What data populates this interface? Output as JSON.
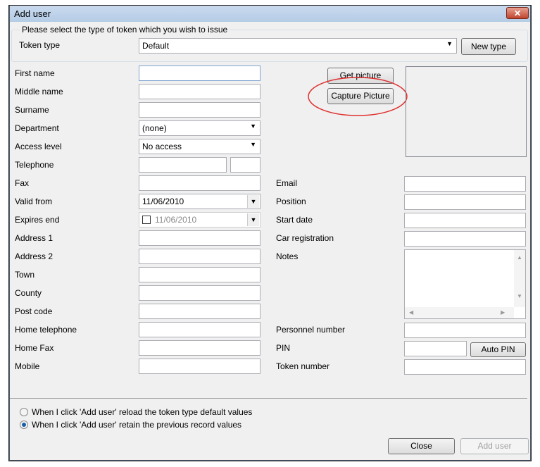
{
  "window": {
    "title": "Add user",
    "close_icon": "close-icon"
  },
  "token_group": {
    "legend": "Please select the type of token which you wish to issue",
    "label": "Token type",
    "value": "Default",
    "new_type": "New type"
  },
  "left_fields": [
    {
      "label": "First name",
      "value": ""
    },
    {
      "label": "Middle name",
      "value": ""
    },
    {
      "label": "Surname",
      "value": ""
    },
    {
      "label": "Department",
      "value": "(none)"
    },
    {
      "label": "Access level",
      "value": "No access"
    },
    {
      "label": "Telephone",
      "value": ""
    },
    {
      "label": "Fax",
      "value": ""
    },
    {
      "label": "Valid from",
      "value": "11/06/2010"
    },
    {
      "label": "Expires end",
      "value": "11/06/2010"
    },
    {
      "label": "Address 1",
      "value": ""
    },
    {
      "label": "Address 2",
      "value": ""
    },
    {
      "label": "Town",
      "value": ""
    },
    {
      "label": "County",
      "value": ""
    },
    {
      "label": "Post code",
      "value": ""
    },
    {
      "label": "Home telephone",
      "value": ""
    },
    {
      "label": "Home Fax",
      "value": ""
    },
    {
      "label": "Mobile",
      "value": ""
    }
  ],
  "right_fields": {
    "email": "Email",
    "position": "Position",
    "start_date": "Start date",
    "car_registration": "Car registration",
    "notes": "Notes",
    "personnel_number": "Personnel number",
    "pin": "PIN",
    "token_number": "Token number"
  },
  "picture": {
    "get_picture": "Get picture",
    "capture_picture": "Capture Picture",
    "highlight_color": "#e03030"
  },
  "auto_pin": "Auto PIN",
  "options": {
    "reload": "When I click 'Add user' reload the token type default values",
    "retain": "When I click 'Add user' retain the previous record values",
    "selected": "retain"
  },
  "footer": {
    "close": "Close",
    "add_user": "Add user"
  }
}
